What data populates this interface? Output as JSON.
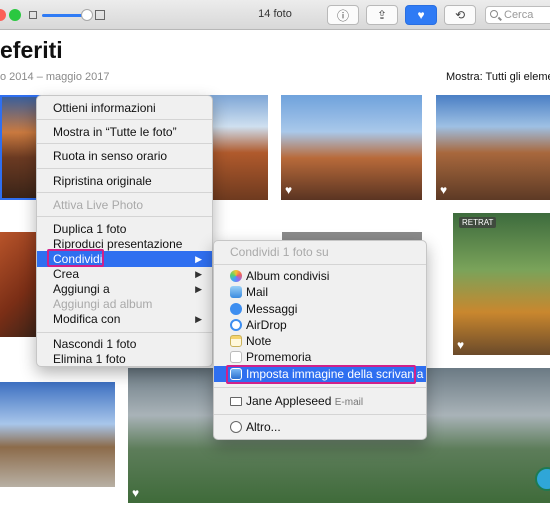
{
  "toolbar": {
    "title": "14 foto",
    "search_placeholder": "Cerca",
    "buttons": {
      "info": "ⓘ",
      "share": "⇪",
      "favorite": "♥",
      "rotate": "⟲"
    }
  },
  "header": {
    "title": "eferiti",
    "date_range": "o 2014 – maggio 2017",
    "show_label": "Mostra:",
    "show_value": "Tutti gli eleme"
  },
  "thumbnails": {
    "badge_text": "RETRAT",
    "heart_glyph": "♥"
  },
  "context_menu": {
    "items": [
      {
        "label": "Ottieni informazioni"
      },
      {
        "label": "Mostra in “Tutte le foto”"
      },
      {
        "label": "Ruota in senso orario"
      },
      {
        "label": "Ripristina originale"
      },
      {
        "label": "Attiva Live Photo",
        "disabled": true
      },
      {
        "label": "Duplica 1 foto"
      },
      {
        "label": "Riproduci presentazione"
      },
      {
        "label": "Condividi",
        "submenu": true,
        "highlighted": true
      },
      {
        "label": "Crea",
        "submenu": true
      },
      {
        "label": "Aggiungi a",
        "submenu": true
      },
      {
        "label": "Aggiungi ad album",
        "disabled": true
      },
      {
        "label": "Modifica con",
        "submenu": true
      },
      {
        "label": "Nascondi 1 foto"
      },
      {
        "label": "Elimina 1 foto"
      }
    ]
  },
  "share_submenu": {
    "header": "Condividi 1 foto su",
    "items": [
      {
        "label": "Album condivisi",
        "icon": "shared-albums-icon"
      },
      {
        "label": "Mail",
        "icon": "mail-icon"
      },
      {
        "label": "Messaggi",
        "icon": "messages-icon"
      },
      {
        "label": "AirDrop",
        "icon": "airdrop-icon"
      },
      {
        "label": "Note",
        "icon": "notes-icon"
      },
      {
        "label": "Promemoria",
        "icon": "reminders-icon"
      },
      {
        "label": "Imposta immagine della scrivania",
        "icon": "desktop-picture-icon",
        "highlighted": true
      },
      {
        "label": "Jane Appleseed",
        "extra": "E-mail",
        "icon": "contact-mail-icon"
      },
      {
        "label": "Altro...",
        "icon": "more-icon"
      }
    ]
  },
  "colors": {
    "accent": "#2f6ff0",
    "outline": "#d0208a"
  }
}
